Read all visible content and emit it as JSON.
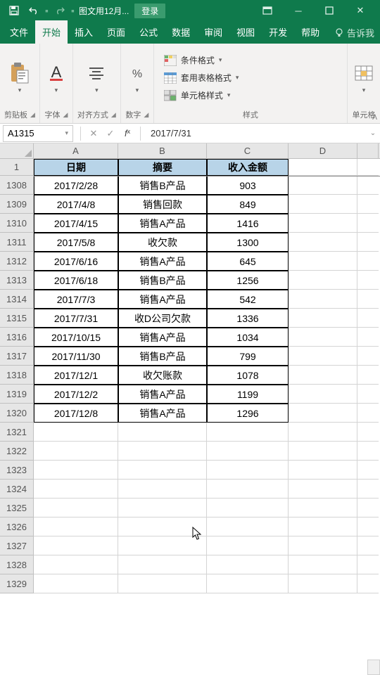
{
  "titlebar": {
    "filename": "图文用12月...",
    "login": "登录"
  },
  "tabs": {
    "file": "文件",
    "home": "开始",
    "insert": "插入",
    "page": "页面",
    "formula": "公式",
    "data": "数据",
    "review": "审阅",
    "view": "视图",
    "dev": "开发",
    "help": "帮助",
    "tellme": "告诉我"
  },
  "ribbon": {
    "clipboard": "剪贴板",
    "font": "字体",
    "align": "对齐方式",
    "number": "数字",
    "styles": "样式",
    "cond_format": "条件格式",
    "table_format": "套用表格格式",
    "cell_styles": "单元格样式",
    "cells_group": "单元格"
  },
  "formula_bar": {
    "name": "A1315",
    "value": "2017/7/31"
  },
  "columns": [
    "A",
    "B",
    "C",
    "D"
  ],
  "header_row": {
    "num": "1",
    "a": "日期",
    "b": "摘要",
    "c": "收入金额"
  },
  "rows": [
    {
      "num": "1308",
      "a": "2017/2/28",
      "b": "销售B产品",
      "c": "903"
    },
    {
      "num": "1309",
      "a": "2017/4/8",
      "b": "销售回款",
      "c": "849"
    },
    {
      "num": "1310",
      "a": "2017/4/15",
      "b": "销售A产品",
      "c": "1416"
    },
    {
      "num": "1311",
      "a": "2017/5/8",
      "b": "收欠款",
      "c": "1300"
    },
    {
      "num": "1312",
      "a": "2017/6/16",
      "b": "销售A产品",
      "c": "645"
    },
    {
      "num": "1313",
      "a": "2017/6/18",
      "b": "销售B产品",
      "c": "1256"
    },
    {
      "num": "1314",
      "a": "2017/7/3",
      "b": "销售A产品",
      "c": "542"
    },
    {
      "num": "1315",
      "a": "2017/7/31",
      "b": "收D公司欠款",
      "c": "1336"
    },
    {
      "num": "1316",
      "a": "2017/10/15",
      "b": "销售A产品",
      "c": "1034"
    },
    {
      "num": "1317",
      "a": "2017/11/30",
      "b": "销售B产品",
      "c": "799"
    },
    {
      "num": "1318",
      "a": "2017/12/1",
      "b": "收欠账款",
      "c": "1078"
    },
    {
      "num": "1319",
      "a": "2017/12/2",
      "b": "销售A产品",
      "c": "1199"
    },
    {
      "num": "1320",
      "a": "2017/12/8",
      "b": "销售A产品",
      "c": "1296"
    }
  ],
  "empty_rows": [
    "1321",
    "1322",
    "1323",
    "1324",
    "1325",
    "1326",
    "1327",
    "1328",
    "1329"
  ]
}
